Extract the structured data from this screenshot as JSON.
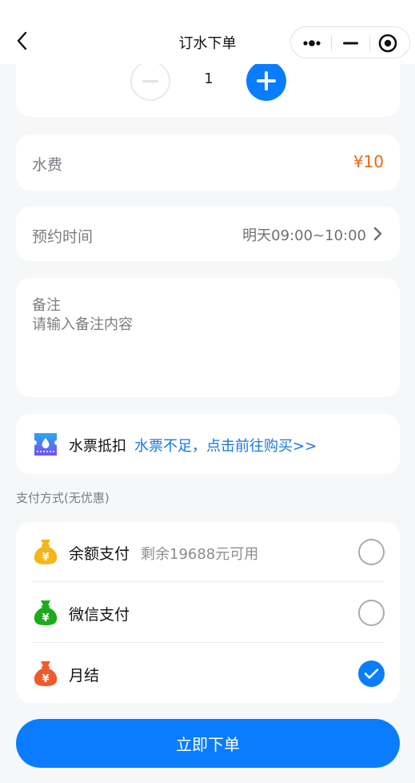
{
  "navbar": {
    "title": "订水下单"
  },
  "quantity": {
    "value": "1"
  },
  "fee": {
    "label": "水费",
    "value": "¥10"
  },
  "appointment": {
    "label": "预约时间",
    "value": "明天09:00~10:00"
  },
  "note": {
    "label": "备注",
    "placeholder": "请输入备注内容"
  },
  "ticket": {
    "label": "水票抵扣",
    "link": "水票不足，点击前往购买>>"
  },
  "payment": {
    "section_title": "支付方式(无优惠)",
    "options": [
      {
        "label": "余额支付",
        "sub": "剩余19688元可用",
        "icon": "money-bag-icon",
        "color": "#f6b619",
        "selected": false
      },
      {
        "label": "微信支付",
        "sub": "",
        "icon": "money-bag-icon",
        "color": "#1aad19",
        "selected": false
      },
      {
        "label": "月结",
        "sub": "",
        "icon": "money-bag-icon",
        "color": "#f05a2a",
        "selected": true
      }
    ]
  },
  "submit": {
    "label": "立即下单"
  },
  "colors": {
    "accent": "#0a7cff",
    "price": "#f0650e",
    "link": "#1677e6"
  }
}
